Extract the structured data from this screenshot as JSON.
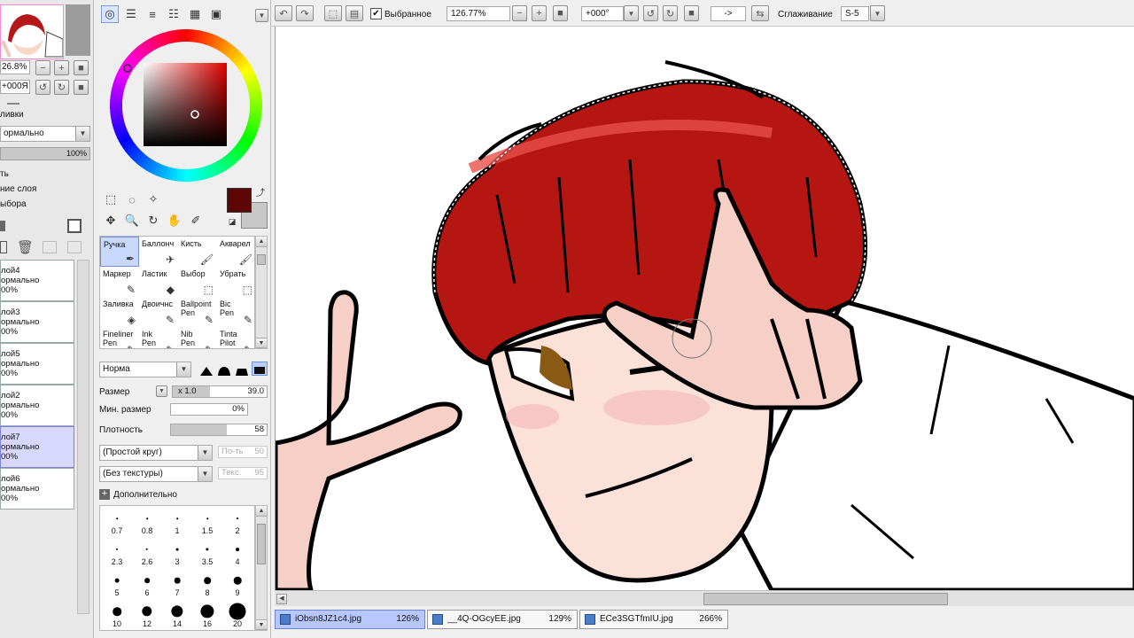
{
  "layer_panel": {
    "zoom": "26.8%",
    "rotation": "+000Я",
    "section_fill": "ливки",
    "blend_mode": "ормально",
    "opacity": "100%",
    "option1": "ть",
    "option2": "ние слоя",
    "option3": "ыбора",
    "layers": [
      {
        "name": "лой4",
        "mode": "ормально",
        "opacity": "00%"
      },
      {
        "name": "лой3",
        "mode": "ормально",
        "opacity": "00%"
      },
      {
        "name": "лой5",
        "mode": "ормально",
        "opacity": "00%"
      },
      {
        "name": "лой2",
        "mode": "ормально",
        "opacity": "00%"
      },
      {
        "name": "лой7",
        "mode": "ормально",
        "opacity": "00%"
      },
      {
        "name": "лой6",
        "mode": "ормально",
        "opacity": "00%"
      }
    ]
  },
  "tool_panel": {
    "brushes": [
      {
        "label": "Ручка",
        "icon": "pen-icon",
        "glyph": "✒"
      },
      {
        "label": "Баллонч",
        "icon": "airbrush-icon",
        "glyph": "✈"
      },
      {
        "label": "Кисть",
        "icon": "brush-icon",
        "glyph": "🖌"
      },
      {
        "label": "Акварел",
        "icon": "watercolor-icon",
        "glyph": "🖌"
      },
      {
        "label": "Маркер",
        "icon": "marker-icon",
        "glyph": "✎"
      },
      {
        "label": "Ластик",
        "icon": "eraser-icon",
        "glyph": "◆"
      },
      {
        "label": "Выбор",
        "icon": "select-pen-icon",
        "glyph": "⬚"
      },
      {
        "label": "Убрать",
        "icon": "deselect-pen-icon",
        "glyph": "⬚"
      },
      {
        "label": "Заливка",
        "icon": "fill-icon",
        "glyph": "◈"
      },
      {
        "label": "Двоичнс",
        "icon": "binary-pen-icon",
        "glyph": "✎"
      },
      {
        "label": "Ballpoint Pen",
        "icon": "ballpoint-icon",
        "glyph": "✎"
      },
      {
        "label": "Bic Pen",
        "icon": "bic-pen-icon",
        "glyph": "✎"
      },
      {
        "label": "Fineliner Pen",
        "icon": "fineliner-icon",
        "glyph": "✎"
      },
      {
        "label": "Ink Pen",
        "icon": "ink-pen-icon",
        "glyph": "✎"
      },
      {
        "label": "Nib Pen",
        "icon": "nib-pen-icon",
        "glyph": "✎"
      },
      {
        "label": "Tinta Pilot",
        "icon": "tinta-pilot-icon",
        "glyph": "✎"
      }
    ],
    "brush_mode": "Норма",
    "size_label": "Размер",
    "size_multiplier": "x 1.0",
    "size_value": "39.0",
    "min_size_label": "Мин. размер",
    "min_size_value": "0%",
    "min_size_level": 0,
    "density_label": "Плотность",
    "density_value": "58",
    "density_level": 0.58,
    "shape_combo": "(Простой круг)",
    "shape_amount_label": "По-ть",
    "shape_amount_value": "50",
    "texture_combo": "(Без текстуры)",
    "texture_amount_label": "Текс.",
    "texture_amount_value": "95",
    "advanced_label": "Дополнительно",
    "brush_sizes": [
      "0.7",
      "0.8",
      "1",
      "1.5",
      "2",
      "2.3",
      "2.6",
      "3",
      "3.5",
      "4",
      "5",
      "6",
      "7",
      "8",
      "9",
      "10",
      "12",
      "14",
      "16",
      "20"
    ],
    "primary_color": "#5c0606",
    "secondary_color": "#c8c8c8"
  },
  "toolbar": {
    "selection_checkbox_label": "Выбранное",
    "zoom": "126.77%",
    "rotation": "+000°",
    "flip_label": "->",
    "smoothing_label": "Сглаживание",
    "smoothing_value": "S-5"
  },
  "doc_tabs": [
    {
      "name": "iObsn8JZ1c4.jpg",
      "zoom": "126%"
    },
    {
      "name": "__4Q-OGcyEE.jpg",
      "zoom": "129%"
    },
    {
      "name": "ECe3SGTfmIU.jpg",
      "zoom": "266%"
    }
  ]
}
